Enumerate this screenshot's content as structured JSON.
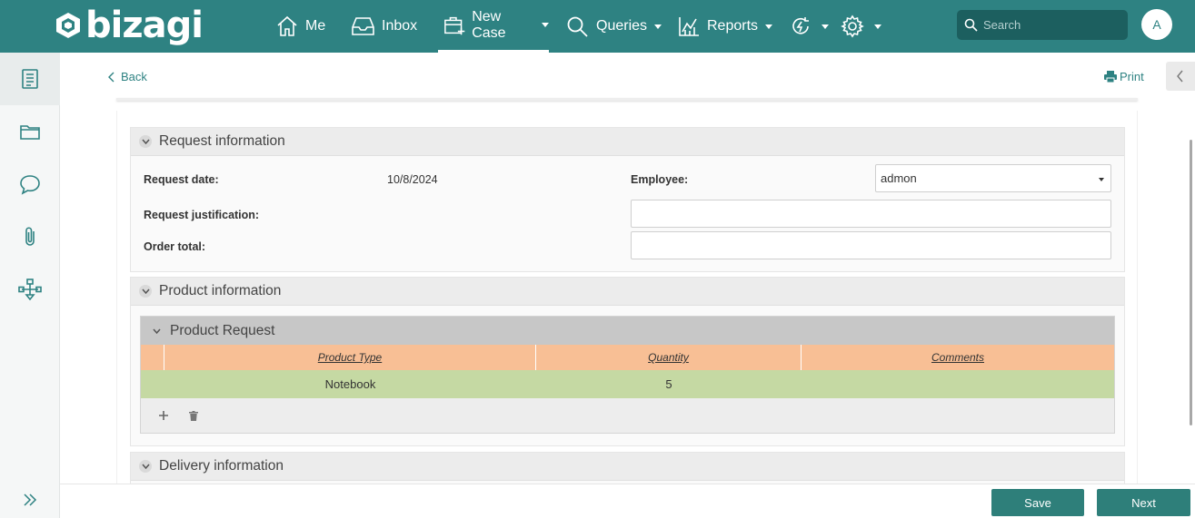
{
  "brand": {
    "name": "bizagi"
  },
  "nav": {
    "me": "Me",
    "inbox": "Inbox",
    "new_case": "New Case",
    "queries": "Queries",
    "reports": "Reports"
  },
  "search": {
    "placeholder": "Search"
  },
  "user": {
    "initial": "A"
  },
  "toolbar": {
    "back": "Back",
    "print": "Print"
  },
  "request_info": {
    "title": "Request information",
    "request_date_label": "Request date:",
    "request_date_value": "10/8/2024",
    "employee_label": "Employee:",
    "employee_value": "admon",
    "justification_label": "Request justification:",
    "justification_value": "",
    "order_total_label": "Order total:",
    "order_total_value": ""
  },
  "product_info": {
    "title": "Product information",
    "grid_title": "Product Request",
    "columns": [
      "Product Type",
      "Quantity",
      "Comments"
    ],
    "rows": [
      {
        "product_type": "Notebook",
        "quantity": "5",
        "comments": ""
      }
    ]
  },
  "delivery_info": {
    "title": "Delivery information"
  },
  "actions": {
    "save": "Save",
    "next": "Next"
  },
  "colors": {
    "brand": "#2e8282",
    "grid_header": "#f8bf95",
    "grid_row": "#c5d9a3",
    "button": "#2e7f7a"
  }
}
